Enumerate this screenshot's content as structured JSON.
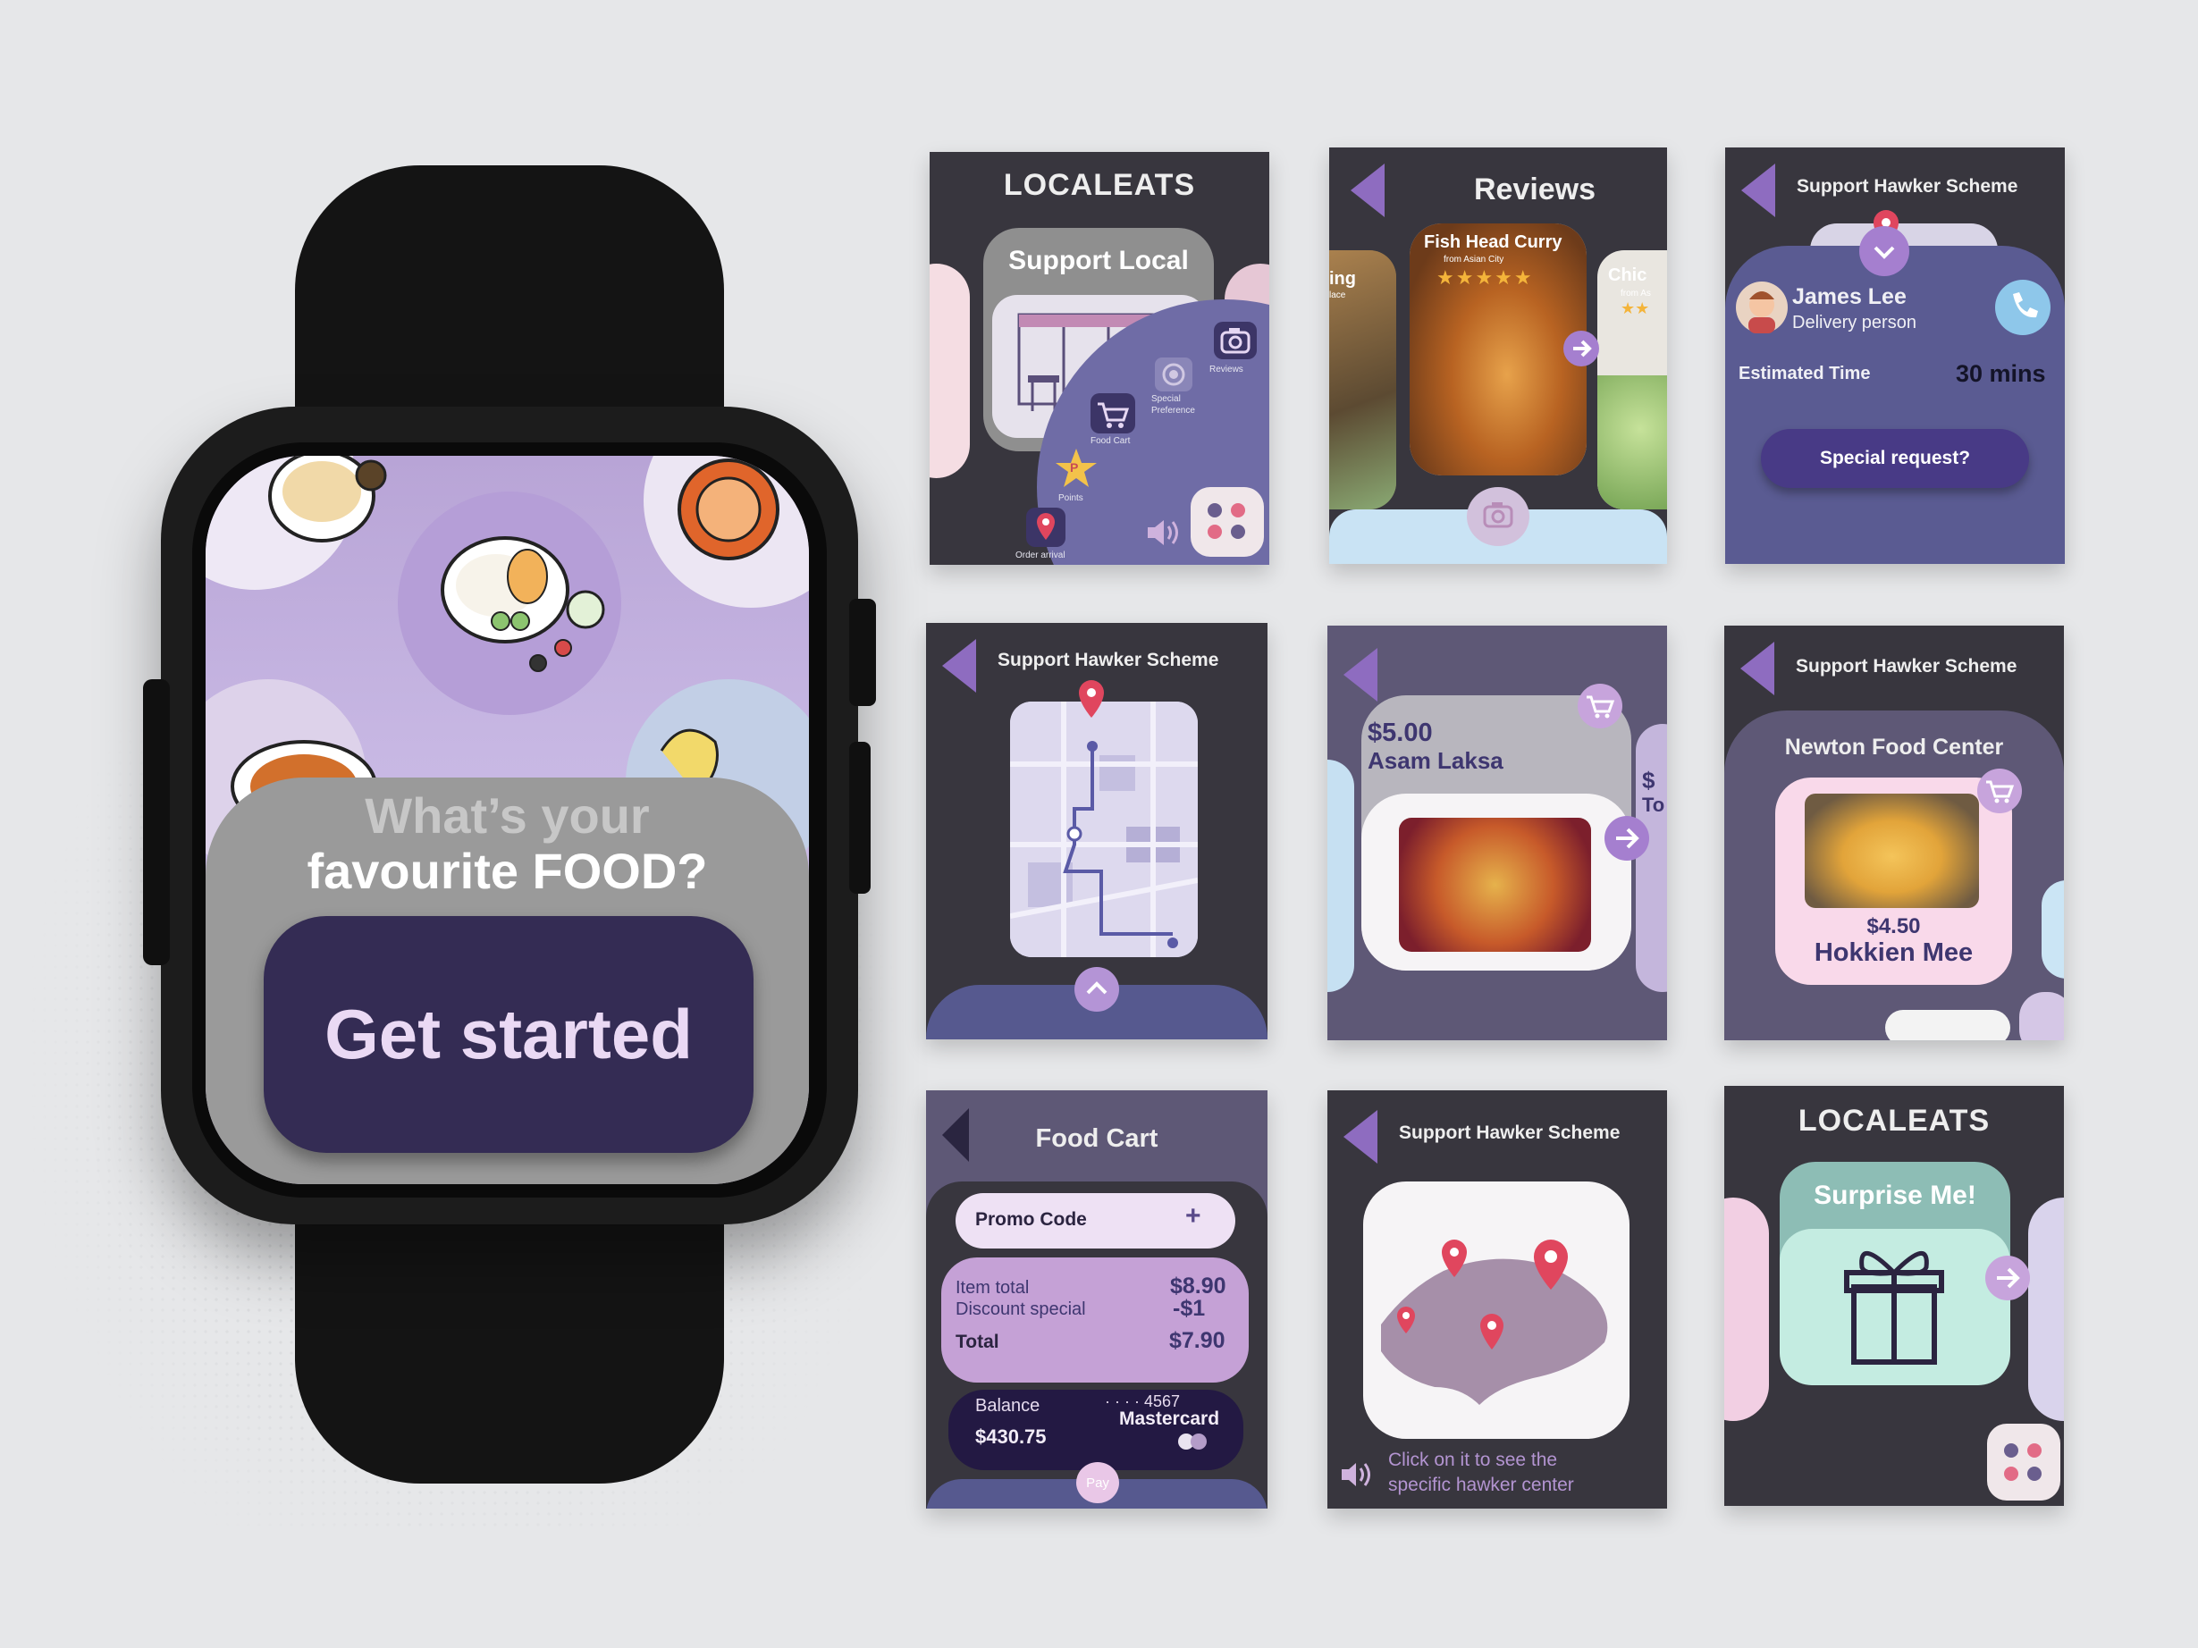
{
  "watch": {
    "question_line1": "What’s your",
    "question_line2": "favourite FOOD?",
    "cta_label": "Get started"
  },
  "card_home": {
    "title": "LOCALEATS",
    "panel_title": "Support Local",
    "menu": {
      "reviews": "Reviews",
      "special_preference": "Special Preference",
      "food_cart": "Food Cart",
      "points": "Points",
      "order_arrival": "Order arrival",
      "points_badge": "P"
    }
  },
  "card_reviews": {
    "title": "Reviews",
    "left_partial": "ing",
    "left_partial_sub": "lace",
    "dish_name": "Fish Head Curry",
    "dish_sub": "from Asian City",
    "stars": "★★★★★",
    "right_partial": "Chic",
    "right_partial_sub": "from As",
    "right_partial_stars": "★★"
  },
  "card_delivery": {
    "title": "Support Hawker Scheme",
    "person_name": "James Lee",
    "person_role": "Delivery person",
    "eta_label": "Estimated Time",
    "eta_value": "30 mins",
    "request_button": "Special request?"
  },
  "card_map_route": {
    "title": "Support Hawker Scheme"
  },
  "card_laksa": {
    "price": "$5.00",
    "dish": "Asam Laksa",
    "next_partial_price": "$",
    "next_partial_name": "To"
  },
  "card_newton": {
    "title": "Support Hawker Scheme",
    "venue": "Newton Food Center",
    "price": "$4.50",
    "dish": "Hokkien Mee"
  },
  "card_cart": {
    "title": "Food Cart",
    "promo_label": "Promo Code",
    "promo_add": "+",
    "item_total_label": "Item total",
    "item_total_value": "$8.90",
    "discount_label": "Discount special",
    "discount_value": "-$1",
    "total_label": "Total",
    "total_value": "$7.90",
    "balance_label": "Balance",
    "balance_value": "$430.75",
    "card_number": "· · · · 4567",
    "card_brand": "Mastercard",
    "pay_label": "Pay"
  },
  "card_sg_map": {
    "title": "Support Hawker Scheme",
    "hint_line1": "Click on it to see the",
    "hint_line2": "specific hawker center"
  },
  "card_surprise": {
    "title": "LOCALEATS",
    "panel_title": "Surprise Me!"
  }
}
